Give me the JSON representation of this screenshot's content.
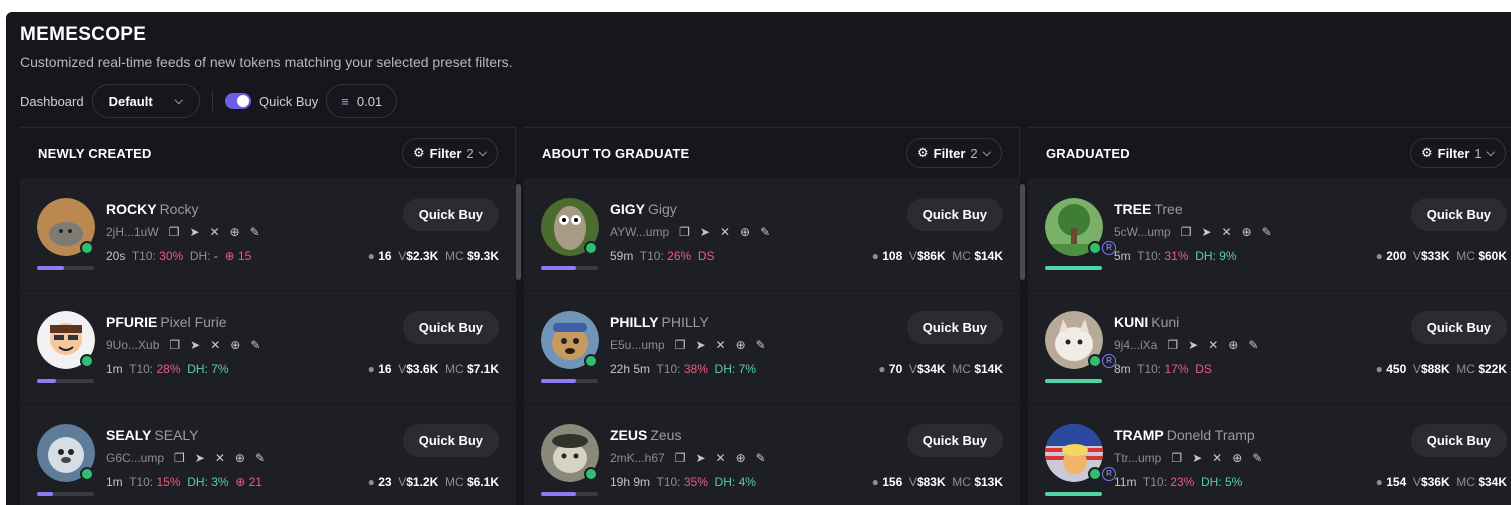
{
  "header": {
    "title": "MEMESCOPE",
    "subtitle": "Customized real-time feeds of new tokens matching your selected preset filters."
  },
  "toolbar": {
    "dashboard_label": "Dashboard",
    "dashboard_value": "Default",
    "quick_buy_label": "Quick Buy",
    "quick_buy_enabled": true,
    "amount": "0.01"
  },
  "columns": [
    {
      "title": "NEWLY CREATED",
      "filter_label": "Filter",
      "filter_count": "2",
      "cards": [
        {
          "ticker": "ROCKY",
          "name": "Rocky",
          "addr": "2jH...1uW",
          "age": "20s",
          "t10": "30%",
          "dh": "-",
          "snipers": "15",
          "holders": "16",
          "volume": "$2.3K",
          "mc": "$9.3K",
          "progress": 0.48,
          "button": "Quick Buy"
        },
        {
          "ticker": "PFURIE",
          "name": "Pixel Furie",
          "addr": "9Uo...Xub",
          "age": "1m",
          "t10": "28%",
          "dh": "7%",
          "holders": "16",
          "volume": "$3.6K",
          "mc": "$7.1K",
          "progress": 0.34,
          "button": "Quick Buy"
        },
        {
          "ticker": "SEALY",
          "name": "SEALY",
          "addr": "G6C...ump",
          "age": "1m",
          "t10": "15%",
          "dh": "3%",
          "snipers": "21",
          "holders": "23",
          "volume": "$1.2K",
          "mc": "$6.1K",
          "progress": 0.28,
          "button": "Quick Buy"
        }
      ]
    },
    {
      "title": "ABOUT TO GRADUATE",
      "filter_label": "Filter",
      "filter_count": "2",
      "cards": [
        {
          "ticker": "GIGY",
          "name": "Gigy",
          "addr": "AYW...ump",
          "age": "59m",
          "t10": "26%",
          "ds": "DS",
          "holders": "108",
          "volume": "$86K",
          "mc": "$14K",
          "progress": 0.62,
          "button": "Quick Buy"
        },
        {
          "ticker": "PHILLY",
          "name": "PHILLY",
          "addr": "E5u...ump",
          "age": "22h 5m",
          "t10": "38%",
          "dh": "7%",
          "holders": "70",
          "volume": "$34K",
          "mc": "$14K",
          "progress": 0.62,
          "button": "Quick Buy"
        },
        {
          "ticker": "ZEUS",
          "name": "Zeus",
          "addr": "2mK...h67",
          "age": "19h 9m",
          "t10": "35%",
          "dh": "4%",
          "holders": "156",
          "volume": "$83K",
          "mc": "$13K",
          "progress": 0.62,
          "button": "Quick Buy"
        }
      ]
    },
    {
      "title": "GRADUATED",
      "filter_label": "Filter",
      "filter_count": "1",
      "cards": [
        {
          "ticker": "TREE",
          "name": "Tree",
          "addr": "5cW...ump",
          "age": "5m",
          "t10": "31%",
          "dh": "9%",
          "holders": "200",
          "volume": "$33K",
          "mc": "$60K",
          "progress": 1,
          "button": "Quick Buy"
        },
        {
          "ticker": "KUNI",
          "name": "Kuni",
          "addr": "9j4...iXa",
          "age": "8m",
          "t10": "17%",
          "ds": "DS",
          "holders": "450",
          "volume": "$88K",
          "mc": "$22K",
          "progress": 1,
          "button": "Quick Buy"
        },
        {
          "ticker": "TRAMP",
          "name": "Doneld Tramp",
          "addr": "Ttr...ump",
          "age": "11m",
          "t10": "23%",
          "dh": "5%",
          "holders": "154",
          "volume": "$36K",
          "mc": "$34K",
          "progress": 1,
          "button": "Quick Buy"
        }
      ]
    }
  ],
  "labels": {
    "t10": "T10:",
    "dh": "DH:",
    "v": "V",
    "mc": "MC"
  },
  "colors": {
    "accent": "#8b7cf6",
    "positive": "#56d3a3",
    "negative": "#ef5b7f",
    "background": "#16161c",
    "card": "#1e1e25"
  }
}
